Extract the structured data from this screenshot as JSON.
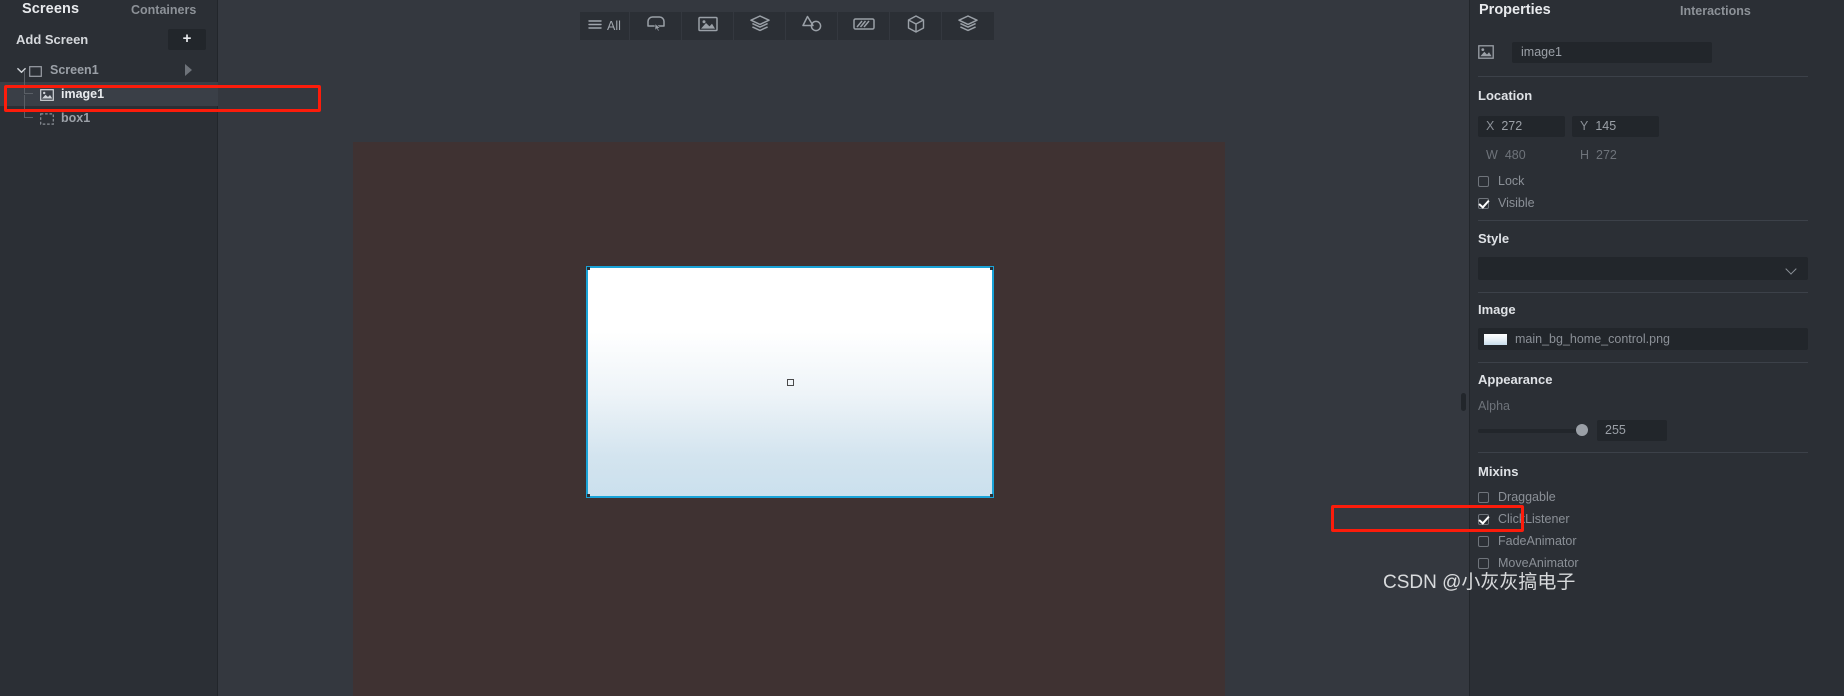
{
  "sidebar": {
    "tabs": [
      {
        "label": "Screens",
        "active": true
      },
      {
        "label": "Containers",
        "active": false
      }
    ],
    "add_screen_label": "Add Screen",
    "add_screen_button": "+",
    "tree": [
      {
        "label": "Screen1",
        "icon": "screen-icon",
        "level": 0,
        "expanded": true,
        "selected": false
      },
      {
        "label": "image1",
        "icon": "image-icon",
        "level": 1,
        "expanded": false,
        "selected": true
      },
      {
        "label": "box1",
        "icon": "box-icon",
        "level": 1,
        "expanded": false,
        "selected": false
      }
    ]
  },
  "toolbar": {
    "buttons": [
      {
        "label": "All",
        "icon": "hamburger-icon"
      },
      {
        "label": "",
        "icon": "button-widget-icon"
      },
      {
        "label": "",
        "icon": "image-widget-icon"
      },
      {
        "label": "",
        "icon": "layers-icon"
      },
      {
        "label": "",
        "icon": "shapes-icon"
      },
      {
        "label": "",
        "icon": "progressbar-icon"
      },
      {
        "label": "",
        "icon": "cube-icon"
      },
      {
        "label": "",
        "icon": "stack-icon"
      }
    ]
  },
  "canvas": {
    "screen_background": "#3f3232",
    "selection_color": "#19a3d8",
    "selected_element": "image1"
  },
  "properties": {
    "tabs": [
      {
        "label": "Properties",
        "active": true
      },
      {
        "label": "Interactions",
        "active": false
      }
    ],
    "name_value": "image1",
    "name_icon": "image-icon",
    "location": {
      "title": "Location",
      "x_key": "X",
      "x_value": "272",
      "y_key": "Y",
      "y_value": "145",
      "w_key": "W",
      "w_value": "480",
      "h_key": "H",
      "h_value": "272",
      "lock": {
        "label": "Lock",
        "checked": false
      },
      "visible": {
        "label": "Visible",
        "checked": true
      }
    },
    "style": {
      "title": "Style",
      "selected": ""
    },
    "image": {
      "title": "Image",
      "file": "main_bg_home_control.png"
    },
    "appearance": {
      "title": "Appearance",
      "alpha_label": "Alpha",
      "alpha_value": "255",
      "alpha_percent": 100
    },
    "mixins": {
      "title": "Mixins",
      "items": [
        {
          "label": "Draggable",
          "checked": false
        },
        {
          "label": "ClickListener",
          "checked": true
        },
        {
          "label": "FadeAnimator",
          "checked": false
        },
        {
          "label": "MoveAnimator",
          "checked": false
        }
      ]
    }
  },
  "annotations": {
    "highlight_color": "#fc1c0b",
    "watermark": "CSDN @小灰灰搞电子"
  }
}
